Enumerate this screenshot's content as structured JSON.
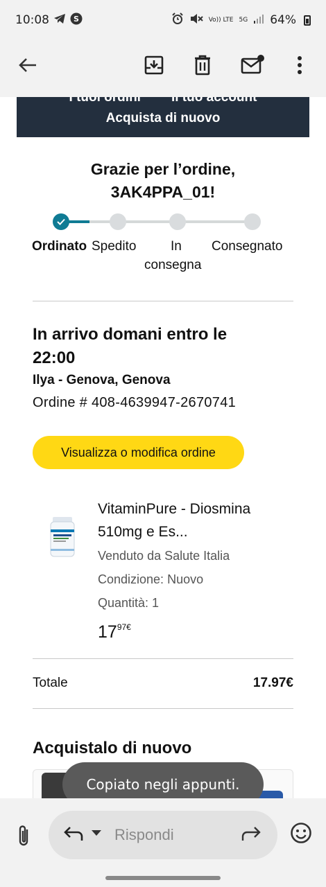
{
  "status_bar": {
    "time": "10:08",
    "left_icons": [
      "telegram-icon",
      "shazam-icon"
    ],
    "right_icons": [
      "alarm-icon",
      "mute-icon",
      "volte-icon",
      "5g-icon",
      "signal-icon"
    ],
    "volte_text": "Vo)) LTE",
    "net_text": "5G",
    "battery": "64%"
  },
  "app_bar": {
    "icons": [
      "back-arrow-icon",
      "archive-icon",
      "trash-icon",
      "mark-unread-icon",
      "more-vert-icon"
    ]
  },
  "email": {
    "nav_links": [
      "I tuoi ordini",
      "Il tuo account"
    ],
    "buy_again_link": "Acquista di nuovo",
    "thanks_line1": "Grazie per l’ordine,",
    "thanks_line2": "3AK4PPA_01!",
    "progress_fraction": 0.15,
    "steps": {
      "ordered": "Ordinato",
      "shipped": "Spedito",
      "in_delivery_1": "In",
      "in_delivery_2": "consegna",
      "delivered": "Consegnato"
    },
    "arrival_line1": "In arrivo domani entro le",
    "arrival_line2": "22:00",
    "recipient": "Ilya - Genova, Genova",
    "order_number": "Ordine # 408-4639947-2670741",
    "cta_label": "Visualizza o modifica ordine",
    "product": {
      "name_line1": "VitaminPure - Diosmina",
      "name_line2": "510mg e Es...",
      "seller": "Venduto da Salute Italia",
      "condition": "Condizione: Nuovo",
      "quantity": "Quantità: 1",
      "price_int": "17",
      "price_dec": "97€"
    },
    "total_label": "Totale",
    "total_value": "17.97€",
    "buy_again_title": "Acquistalo di nuovo"
  },
  "toast": "Copiato negli appunti.",
  "reply_bar": {
    "placeholder": "Rispondi",
    "icons": [
      "attach-icon",
      "reply-icon",
      "forward-icon",
      "emoji-icon"
    ]
  },
  "colors": {
    "amazon_dark": "#232f3e",
    "progress_active": "#0f7b94",
    "cta_yellow": "#ffd814"
  }
}
